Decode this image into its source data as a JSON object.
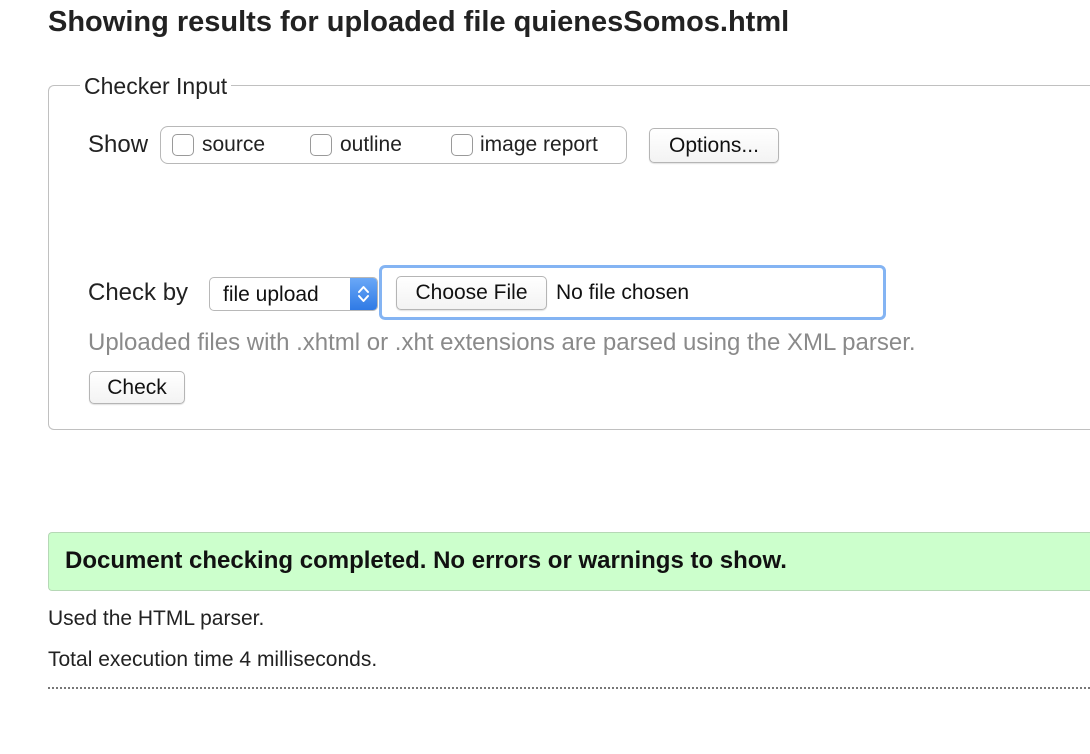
{
  "page": {
    "title": "Showing results for uploaded file quienesSomos.html"
  },
  "checker_input": {
    "legend": "Checker Input",
    "show_label": "Show",
    "checkboxes": [
      {
        "label": "source",
        "checked": false
      },
      {
        "label": "outline",
        "checked": false
      },
      {
        "label": "image report",
        "checked": false
      }
    ],
    "options_button": "Options...",
    "check_by_label": "Check by",
    "check_by_select": {
      "value": "file upload"
    },
    "file_input": {
      "button_label": "Choose File",
      "status": "No file chosen"
    },
    "hint": "Uploaded files with .xhtml or .xht extensions are parsed using the XML parser.",
    "check_button": "Check"
  },
  "results": {
    "success_message": "Document checking completed. No errors or warnings to show.",
    "parser_info": "Used the HTML parser.",
    "execution_time": "Total execution time 4 milliseconds."
  },
  "colors": {
    "success_background": "#ccffcc",
    "focus_ring": "#84b4f3",
    "select_accent": "#2f7ae5",
    "hint_text": "#8a8a8a"
  },
  "icons": {
    "select_arrow": "chevron-up-down-icon"
  }
}
